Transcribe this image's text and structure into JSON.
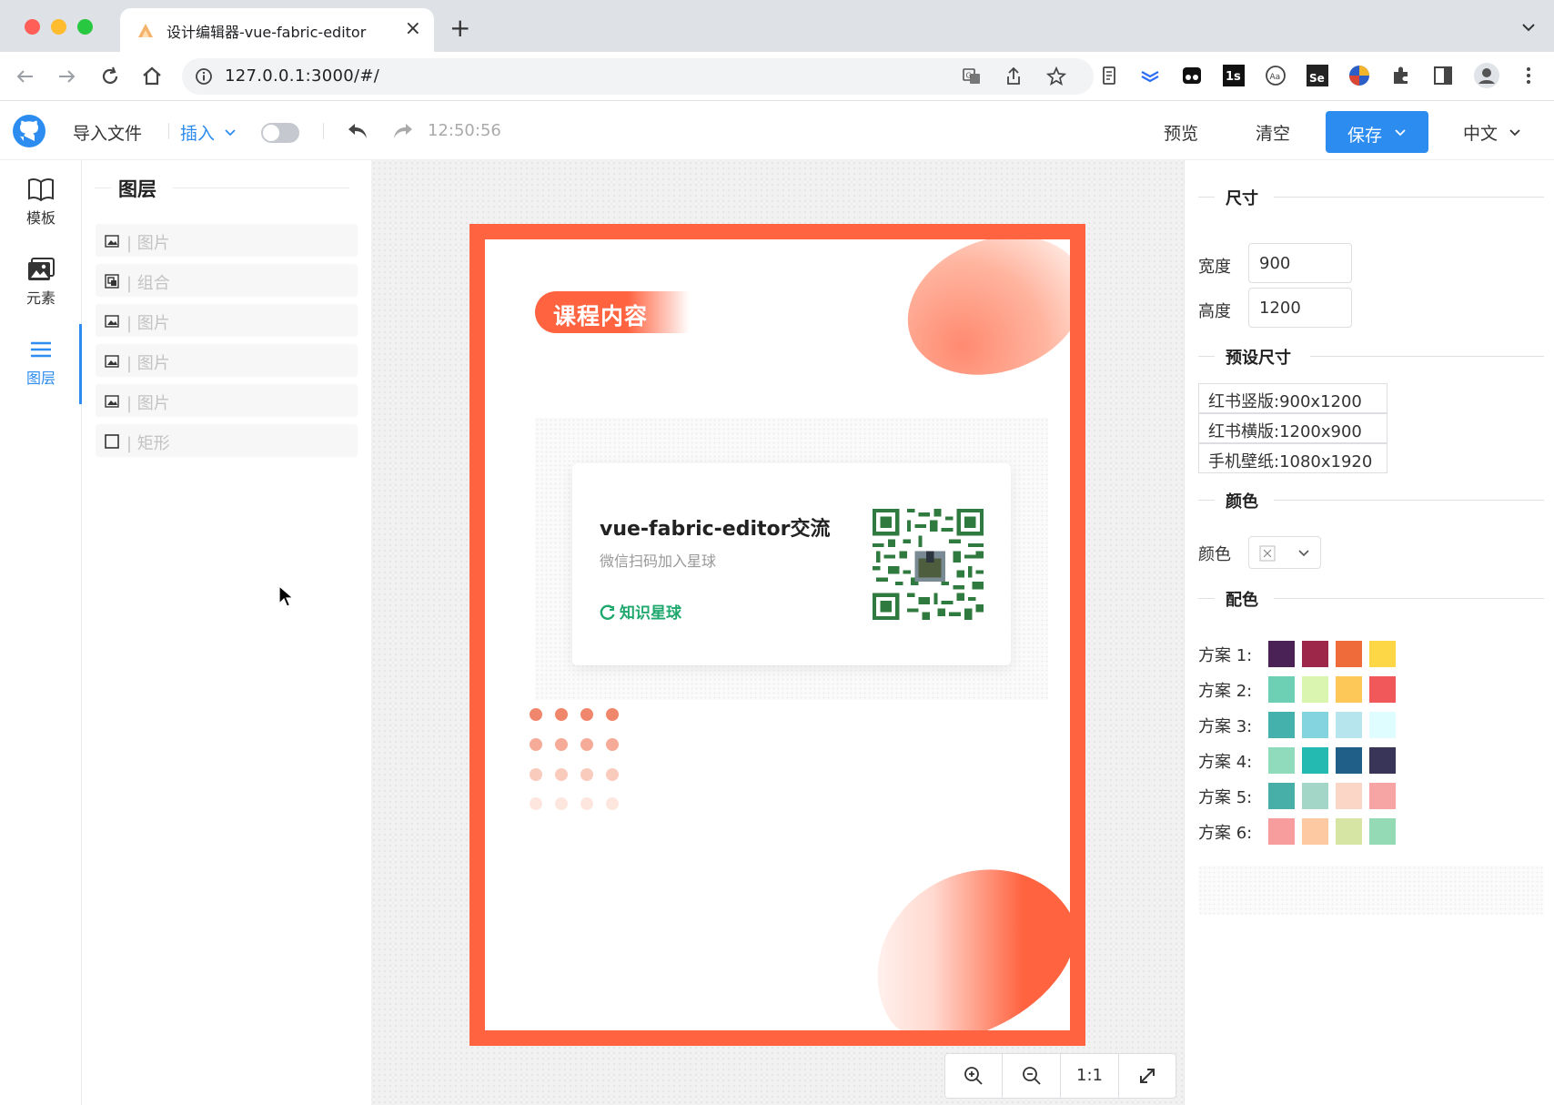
{
  "browser": {
    "tab_title": "设计编辑器-vue-fabric-editor",
    "url": "127.0.0.1:3000/#/"
  },
  "header": {
    "import": "导入文件",
    "insert": "插入",
    "time": "12:50:56",
    "preview": "预览",
    "clear": "清空",
    "save": "保存",
    "language": "中文"
  },
  "iconbar": {
    "items": [
      {
        "label": "模板",
        "icon": "book-icon"
      },
      {
        "label": "元素",
        "icon": "images-icon"
      },
      {
        "label": "图层",
        "icon": "layers-icon"
      }
    ]
  },
  "layers": {
    "title": "图层",
    "items": [
      {
        "type": "image",
        "label": "| 图片"
      },
      {
        "type": "group",
        "label": "| 组合"
      },
      {
        "type": "image",
        "label": "| 图片"
      },
      {
        "type": "image",
        "label": "| 图片"
      },
      {
        "type": "image",
        "label": "| 图片"
      },
      {
        "type": "rect",
        "label": "| 矩形"
      }
    ]
  },
  "canvas": {
    "badge": "课程内容",
    "card_title": "vue-fabric-editor交流",
    "card_subtitle": "微信扫码加入星球",
    "card_brand": "知识星球",
    "zoom_reset": "1:1"
  },
  "props": {
    "size_title": "尺寸",
    "width_label": "宽度",
    "width_value": "900",
    "height_label": "高度",
    "height_value": "1200",
    "preset_title": "预设尺寸",
    "presets": [
      "红书竖版:900x1200",
      "红书横版:1200x900",
      "手机壁纸:1080x1920"
    ],
    "color_title": "颜色",
    "color_label": "颜色",
    "palette_title": "配色",
    "schemes": [
      {
        "label": "方案 1:",
        "colors": [
          "#4a2255",
          "#9c2749",
          "#ef6c3a",
          "#fdd745"
        ]
      },
      {
        "label": "方案 2:",
        "colors": [
          "#6dcfb3",
          "#d9f5b0",
          "#fdc858",
          "#f0585a"
        ]
      },
      {
        "label": "方案 3:",
        "colors": [
          "#45b1ad",
          "#84d4e0",
          "#b6e5ee",
          "#dffcff"
        ]
      },
      {
        "label": "方案 4:",
        "colors": [
          "#8fdbbc",
          "#24b9b1",
          "#205f88",
          "#383559"
        ]
      },
      {
        "label": "方案 5:",
        "colors": [
          "#48aea8",
          "#a3d6c6",
          "#fbd6c7",
          "#f7a4a4"
        ]
      },
      {
        "label": "方案 6:",
        "colors": [
          "#f89d9d",
          "#fcc9a3",
          "#d6e4a4",
          "#94dab4"
        ]
      }
    ]
  },
  "colors": {
    "accent": "#2d8cf0",
    "poster_red": "#ff6340",
    "brand_green": "#1fa86d"
  }
}
